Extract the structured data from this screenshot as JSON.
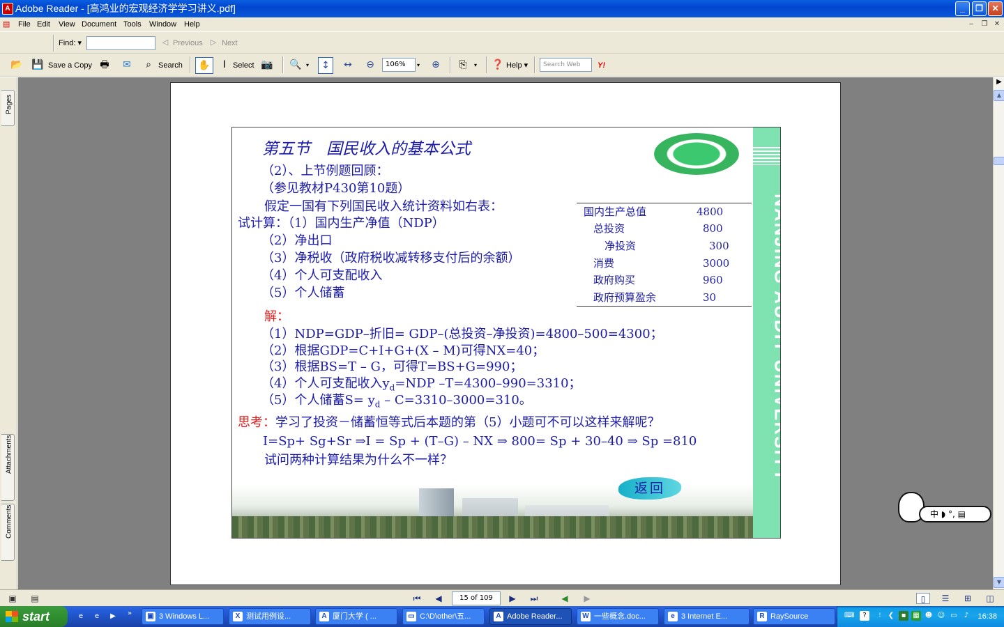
{
  "window": {
    "title": "Adobe Reader - [高鸿业的宏观经济学学习讲义.pdf]",
    "app_icon": "adobe-reader-icon",
    "controls": [
      "minimize",
      "restore",
      "close"
    ]
  },
  "menubar": {
    "items": [
      "File",
      "Edit",
      "View",
      "Document",
      "Tools",
      "Window",
      "Help"
    ]
  },
  "findbar": {
    "find_label": "Find:",
    "find_value": "",
    "previous_label": "Previous",
    "next_label": "Next"
  },
  "toolbar": {
    "save_copy_label": "Save a Copy",
    "search_label": "Search",
    "select_label": "Select",
    "zoom_value": "106%",
    "help_label": "Help",
    "search_web_placeholder": "Search Web",
    "yahoo_label": "Y!"
  },
  "side_tabs": [
    "Pages",
    "Attachments",
    "Comments"
  ],
  "slide": {
    "title": "第五节　国民收入的基本公式",
    "line1": "（2）、上节例题回顾：",
    "line2": "（参见教材P430第10题）",
    "line3": "假定一国有下列国民收入统计资料如右表：",
    "line4": "试计算：（1）国内生产净值（NDP）",
    "line5": "（2）净出口",
    "line6": "（3）净税收（政府税收减转移支付后的余额）",
    "line7": "（4）个人可支配收入",
    "line8": "（5）个人储蓄",
    "answer_label": "解：",
    "ans1": "（1）NDP=GDP–折旧= GDP–(总投资–净投资)=4800–500=4300；",
    "ans2": "（2）根据GDP=C+I+G+(X – M)可得NX=40；",
    "ans3": "（3）根据BS=T – G，可得T=BS+G=990；",
    "ans4_a": "（4）个人可支配收入y",
    "ans4_sub": "d",
    "ans4_b": "=NDP –T=4300–990=3310；",
    "ans5_a": "（5）个人储蓄S= y",
    "ans5_sub": "d",
    "ans5_b": " – C=3310–3000=310。",
    "think_label": "思考：",
    "think_text": "学习了投资－储蓄恒等式后本题的第（5）小题可不可以这样来解呢？",
    "formula": "I=Sp+ Sg+Sr ⇒I = Sp + (T–G) – NX ⇒ 800= Sp + 30–40 ⇒ Sp =810",
    "question": "试问两种计算结果为什么不一样？",
    "back_button": "返回",
    "university_text": "NANJING  AUDIT  UNIVERSITY",
    "table": [
      {
        "label": "国内生产总值",
        "value": "4800"
      },
      {
        "label": "总投资",
        "value": "800"
      },
      {
        "label": "净投资",
        "value": "300"
      },
      {
        "label": "消费",
        "value": "3000"
      },
      {
        "label": "政府购买",
        "value": "960"
      },
      {
        "label": "政府预算盈余",
        "value": "30"
      }
    ]
  },
  "navigation": {
    "page_indicator": "15 of 109"
  },
  "taskbar": {
    "start_label": "start",
    "tasks": [
      {
        "label": "3 Windows L...",
        "icon": "windows-group-icon"
      },
      {
        "label": "测试用例设...",
        "icon": "excel-icon"
      },
      {
        "label": "厦门大学 ( ...",
        "icon": "pdf-icon"
      },
      {
        "label": "C:\\D\\other\\五...",
        "icon": "folder-icon"
      },
      {
        "label": "Adobe Reader...",
        "icon": "adobe-reader-icon"
      },
      {
        "label": "一些概念.doc...",
        "icon": "word-icon"
      },
      {
        "label": "3 Internet E...",
        "icon": "ie-icon"
      },
      {
        "label": "RaySource",
        "icon": "raysource-icon"
      }
    ],
    "clock": "16:38"
  },
  "ime": {
    "text": "中 ◗ °, ▤"
  },
  "colors": {
    "slide_text": "#1c1ca8",
    "slide_red": "#e02020",
    "green_band": "#7ee3b0",
    "titlebar": "#0a5fe0"
  }
}
